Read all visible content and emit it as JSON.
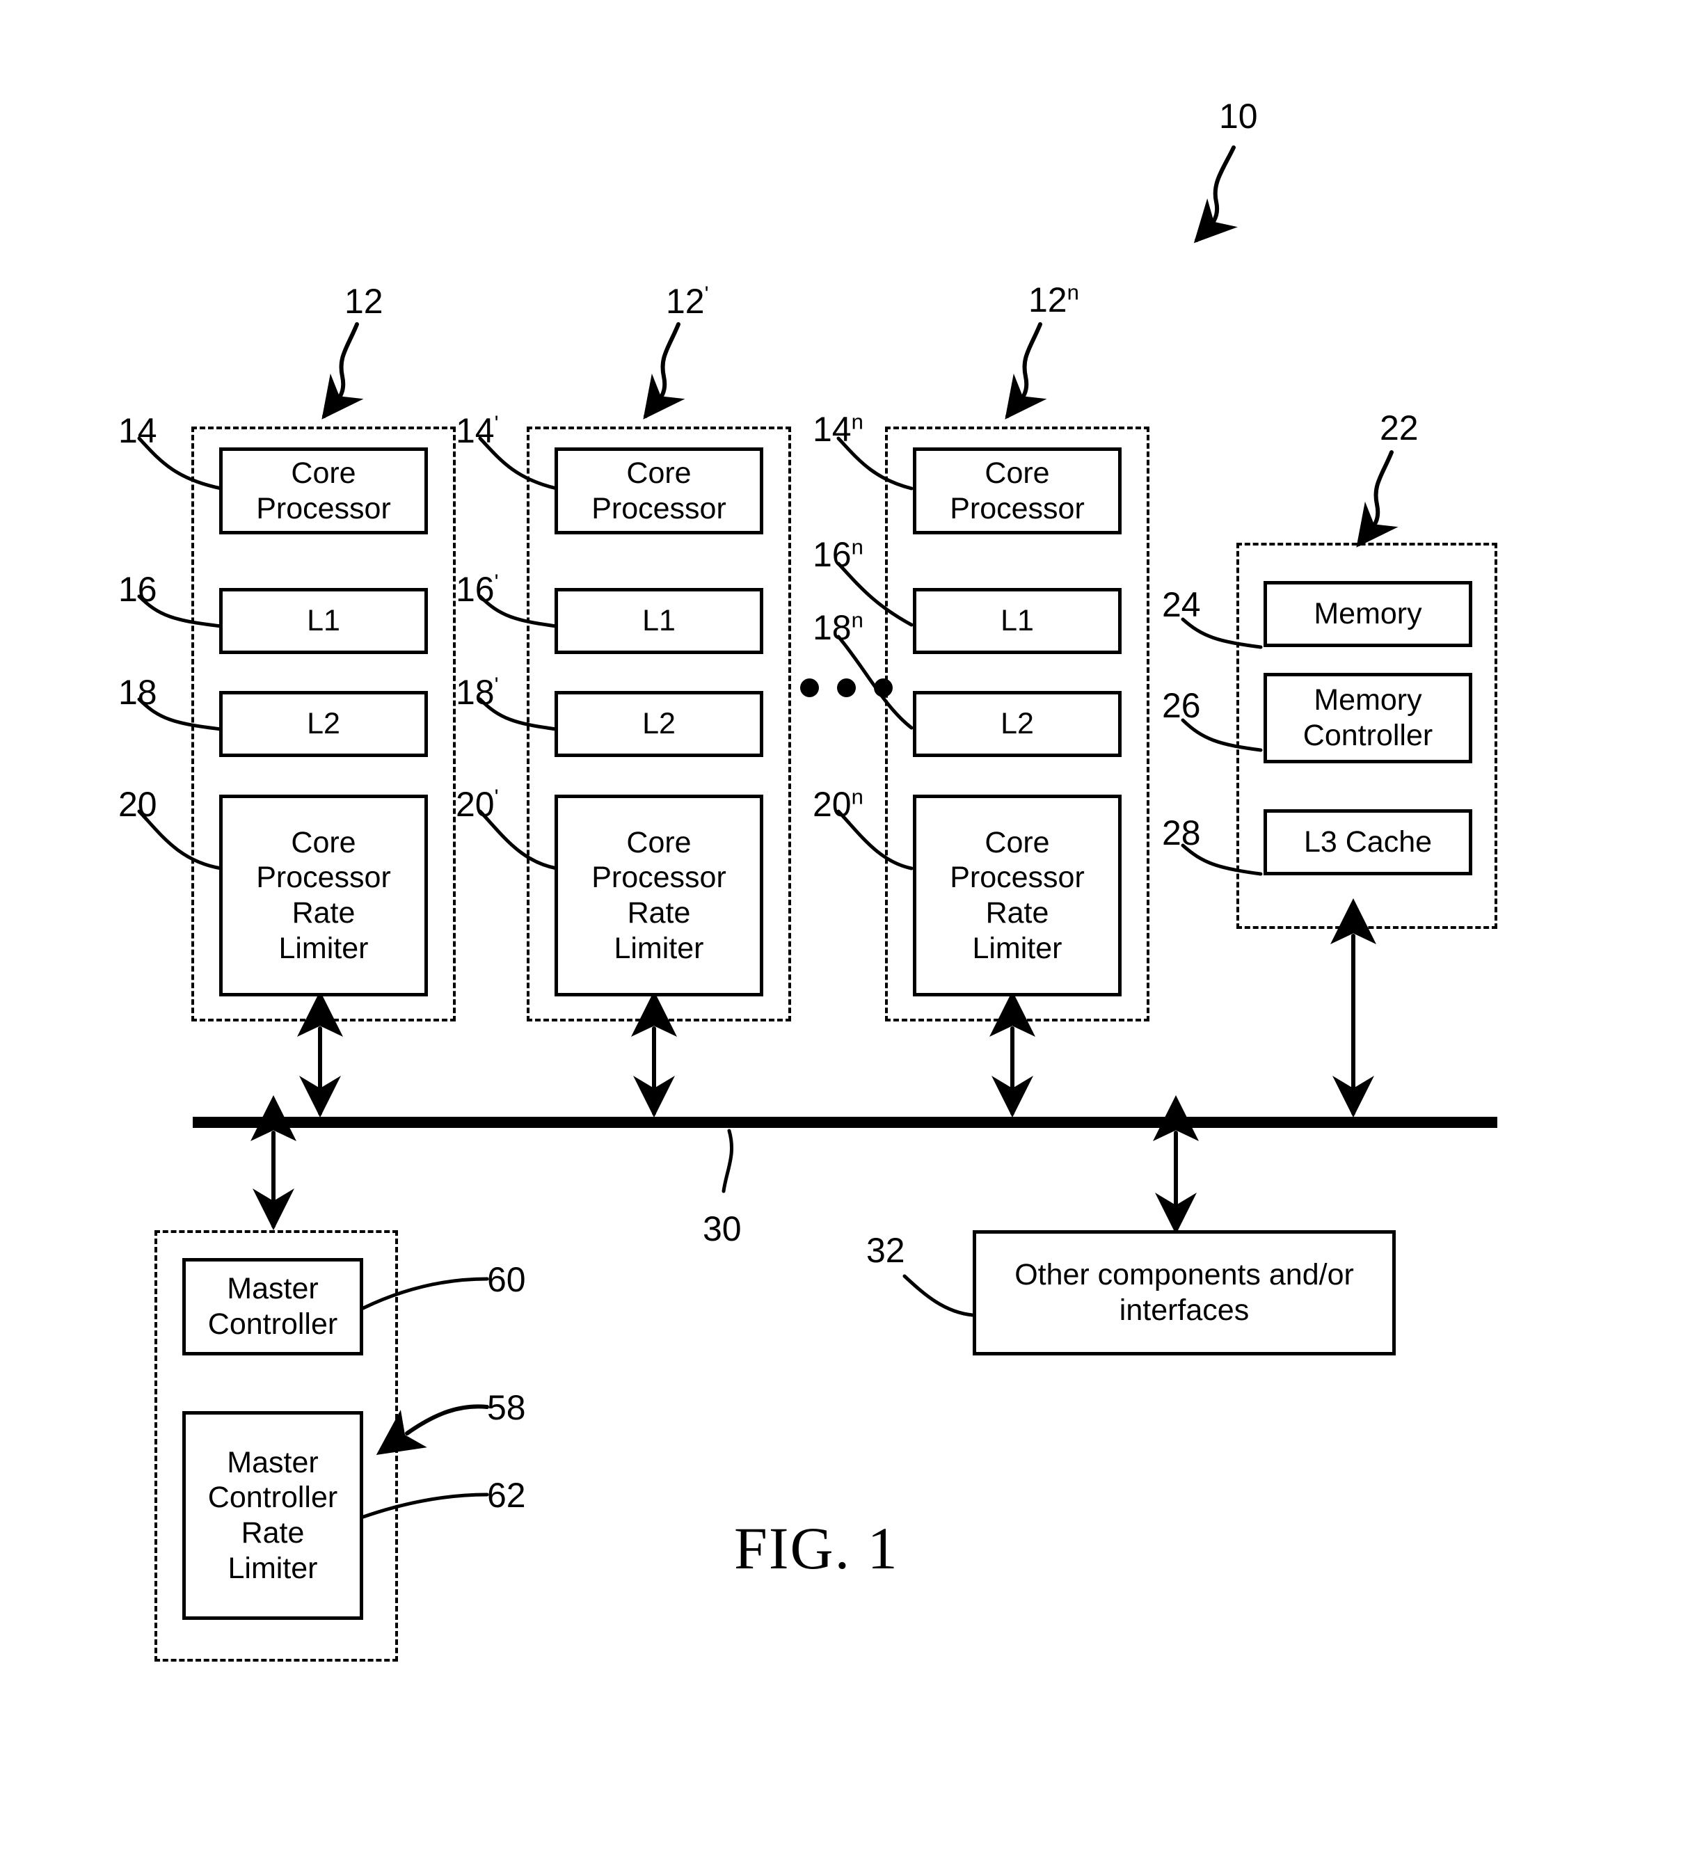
{
  "figure": {
    "caption": "FIG. 1",
    "system_ref": "10"
  },
  "cores": [
    {
      "group_ref": "12",
      "group_ref_sup": "",
      "blocks": [
        {
          "ref": "14",
          "ref_sup": "",
          "label": "Core\nProcessor"
        },
        {
          "ref": "16",
          "ref_sup": "",
          "label": "L1"
        },
        {
          "ref": "18",
          "ref_sup": "",
          "label": "L2"
        },
        {
          "ref": "20",
          "ref_sup": "",
          "label": "Core\nProcessor\nRate\nLimiter"
        }
      ]
    },
    {
      "group_ref": "12",
      "group_ref_sup": "'",
      "blocks": [
        {
          "ref": "14",
          "ref_sup": "'",
          "label": "Core\nProcessor"
        },
        {
          "ref": "16",
          "ref_sup": "'",
          "label": "L1"
        },
        {
          "ref": "18",
          "ref_sup": "'",
          "label": "L2"
        },
        {
          "ref": "20",
          "ref_sup": "'",
          "label": "Core\nProcessor\nRate\nLimiter"
        }
      ]
    },
    {
      "group_ref": "12",
      "group_ref_sup": "n",
      "blocks": [
        {
          "ref": "14",
          "ref_sup": "n",
          "label": "Core\nProcessor"
        },
        {
          "ref": "16",
          "ref_sup": "n",
          "label": "L1"
        },
        {
          "ref": "18",
          "ref_sup": "n",
          "label": "L2"
        },
        {
          "ref": "20",
          "ref_sup": "n",
          "label": "Core\nProcessor\nRate\nLimiter"
        }
      ]
    }
  ],
  "memory_group": {
    "group_ref": "22",
    "blocks": [
      {
        "ref": "24",
        "label": "Memory"
      },
      {
        "ref": "26",
        "label": "Memory\nController"
      },
      {
        "ref": "28",
        "label": "L3 Cache"
      }
    ]
  },
  "bus": {
    "ref": "30"
  },
  "master_group": {
    "group_ref": "58",
    "blocks": [
      {
        "ref": "60",
        "label": "Master\nController"
      },
      {
        "ref": "62",
        "label": "Master\nController\nRate\nLimiter"
      }
    ]
  },
  "other_components": {
    "ref": "32",
    "label": "Other components and/or\ninterfaces"
  },
  "ellipsis": "• • •",
  "colors": {
    "line": "#000000",
    "background": "#ffffff"
  }
}
